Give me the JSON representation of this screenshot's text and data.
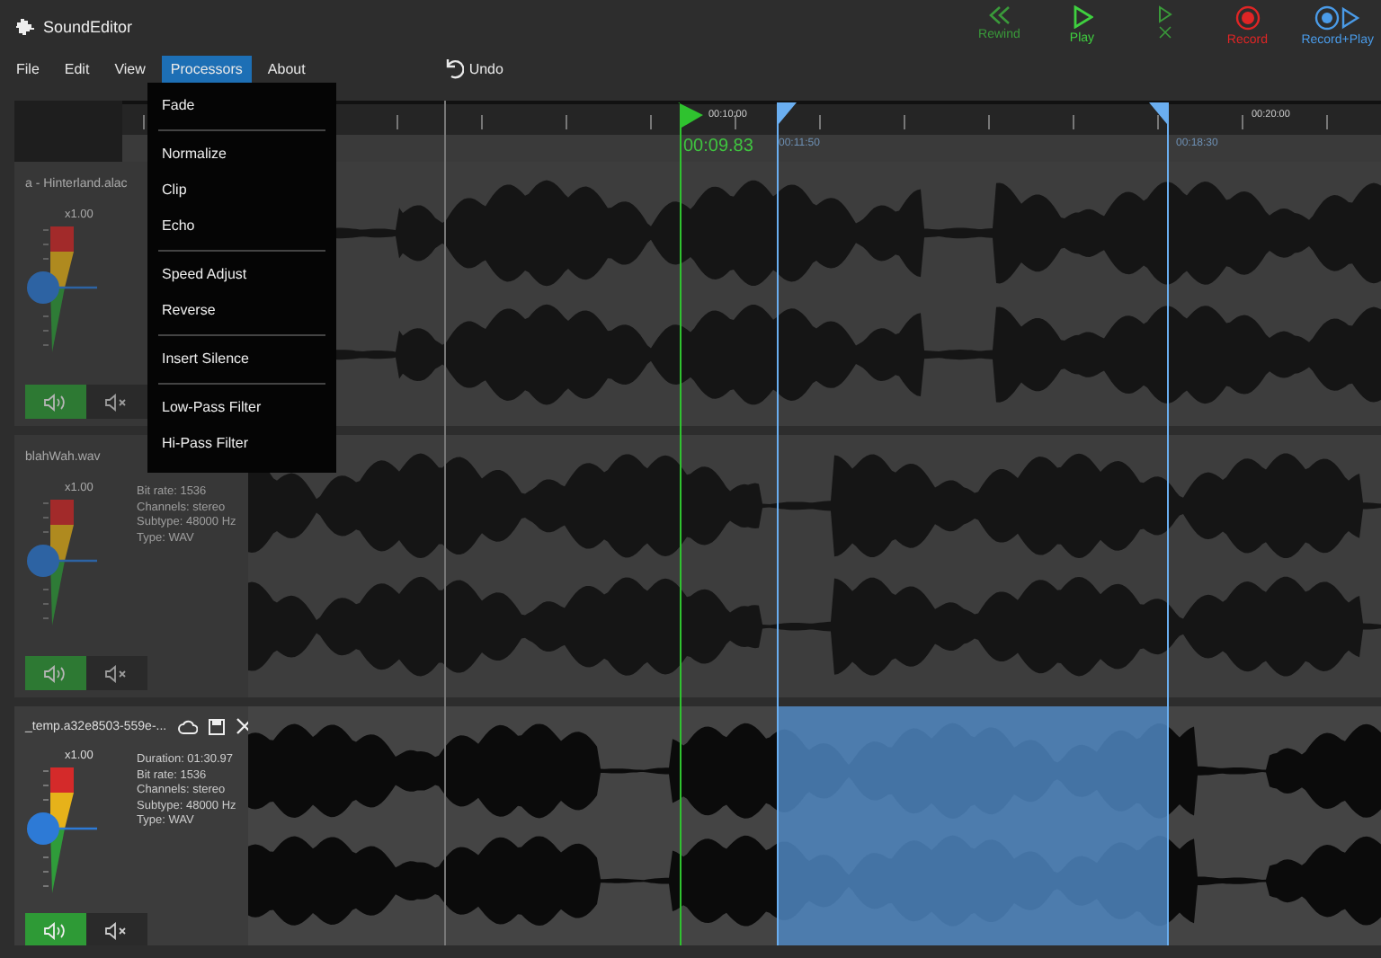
{
  "app": {
    "title": "SoundEditor"
  },
  "transport": [
    {
      "kind": "rewind",
      "label": "Rewind",
      "color": "#3a9a3a"
    },
    {
      "kind": "play",
      "label": "Play",
      "color": "#3fd03f"
    },
    {
      "kind": "step",
      "color": "#3a9a3a"
    },
    {
      "kind": "record",
      "label": "Record",
      "color": "#e02525"
    },
    {
      "kind": "record_play",
      "label": "Record+Play",
      "color": "#4a9be8"
    }
  ],
  "menu_bar": [
    {
      "label": "File",
      "selected": false
    },
    {
      "label": "Edit",
      "selected": false
    },
    {
      "label": "View",
      "selected": false
    },
    {
      "label": "Processors",
      "selected": true
    },
    {
      "label": "About",
      "selected": false
    }
  ],
  "undo": {
    "label": "Undo"
  },
  "processors_menu": {
    "groups": [
      [
        "Fade"
      ],
      [
        "Normalize",
        "Clip",
        "Echo"
      ],
      [
        "Speed Adjust",
        "Reverse"
      ],
      [
        "Insert Silence"
      ],
      [
        "Low-Pass Filter",
        "Hi-Pass Filter"
      ]
    ]
  },
  "timeline": {
    "tick_labels": [
      "00:10:00",
      "00:20:00"
    ],
    "selection_labels": [
      "00:11:50",
      "00:18:30"
    ],
    "playhead_time": "00:09.83"
  },
  "tracks": [
    {
      "name": "a - Hinterland.alac",
      "selected": false,
      "gain": "x1.00",
      "sound_on": true,
      "toolbar": false
    },
    {
      "name": "blahWah.wav",
      "selected": false,
      "gain": "x1.00",
      "info": [
        "Bit rate: 1536",
        "Channels: stereo",
        "Subtype: 48000 Hz",
        "Type: WAV"
      ],
      "sound_on": true,
      "toolbar": false
    },
    {
      "name": "_temp.a32e8503-559e-...",
      "selected": true,
      "gain": "x1.00",
      "info": [
        "Duration: 01:30.97",
        "Bit rate: 1536",
        "Channels: stereo",
        "Subtype: 48000 Hz",
        "Type: WAV"
      ],
      "sound_on": true,
      "toolbar": true
    }
  ]
}
